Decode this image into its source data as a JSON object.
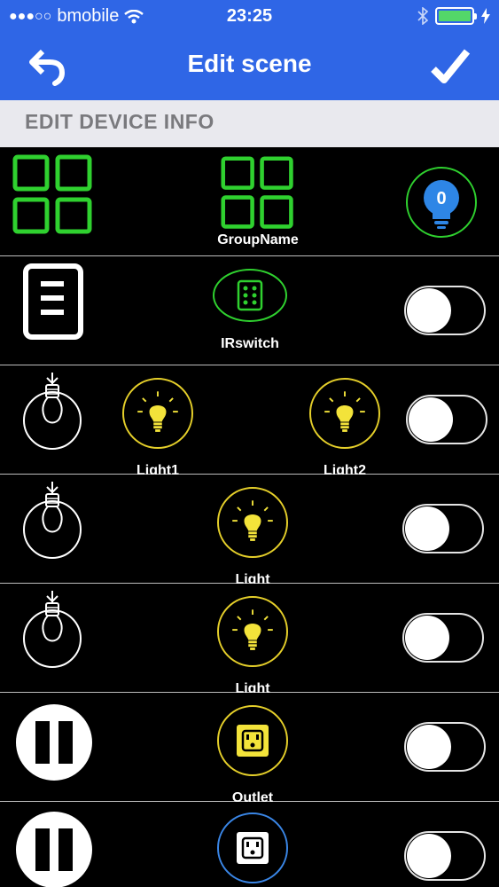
{
  "status": {
    "carrier": "bmobile",
    "time": "23:25"
  },
  "nav": {
    "title": "Edit scene",
    "back_icon": "back-arrow-icon",
    "done_icon": "checkmark-icon"
  },
  "section": {
    "header": "EDIT DEVICE INFO"
  },
  "rows": [
    {
      "type": "group",
      "devices": [
        {
          "label": "GroupName"
        }
      ],
      "badge": "0"
    },
    {
      "type": "ir-switch",
      "devices": [
        {
          "label": "IRswitch"
        }
      ],
      "toggle_on": false
    },
    {
      "type": "light",
      "devices": [
        {
          "label": "Light1"
        },
        {
          "label": "Light2"
        }
      ],
      "toggle_on": false
    },
    {
      "type": "light",
      "devices": [
        {
          "label": "Light"
        }
      ],
      "toggle_on": false
    },
    {
      "type": "light",
      "devices": [
        {
          "label": "Light"
        }
      ],
      "toggle_on": false
    },
    {
      "type": "outlet",
      "devices": [
        {
          "label": "Outlet"
        }
      ],
      "toggle_on": false
    },
    {
      "type": "outlet",
      "devices": [
        {
          "label": ""
        }
      ],
      "toggle_on": false
    }
  ],
  "colors": {
    "primary_blue": "#2f66e6",
    "green": "#2fd12f",
    "yellow": "#e5cf2a",
    "blue_ring": "#3a86e6",
    "battery": "#53d769"
  }
}
